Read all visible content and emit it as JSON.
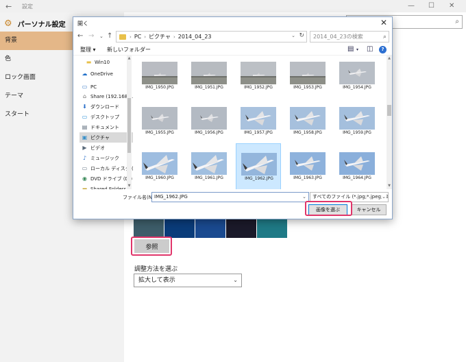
{
  "settings": {
    "title": "設定",
    "sidebar": {
      "header": "パーソナル設定",
      "items": [
        {
          "label": "背景",
          "active": true
        },
        {
          "label": "色",
          "active": false
        },
        {
          "label": "ロック画面",
          "active": false
        },
        {
          "label": "テーマ",
          "active": false
        },
        {
          "label": "スタート",
          "active": false
        }
      ]
    },
    "browse_label": "参照",
    "fit_label": "調整方法を選ぶ",
    "fit_value": "拡大して表示",
    "thumb_colors": [
      "#3d5d6a",
      "#0a3c7a",
      "#1a4a90",
      "#1b1a2a",
      "#1f7a86"
    ]
  },
  "dialog": {
    "title": "開く",
    "breadcrumb": [
      "PC",
      "ピクチャ",
      "2014_04_23"
    ],
    "search_placeholder": "2014_04_23の検索",
    "toolbar": {
      "organize": "整理 ▾",
      "new_folder": "新しいフォルダー"
    },
    "nav": [
      {
        "icon": "folder-icon",
        "label": "Win10",
        "color": "#e8c04a"
      },
      {
        "icon": "cloud-icon",
        "label": "OneDrive",
        "color": "#1f6fc9"
      },
      {
        "icon": "pc-icon",
        "label": "PC",
        "color": "#3a7bc8"
      },
      {
        "icon": "network-share-icon",
        "label": "Share (192.168.1.",
        "color": "#6a6a6a"
      },
      {
        "icon": "download-icon",
        "label": "ダウンロード",
        "color": "#2a6fc9"
      },
      {
        "icon": "desktop-icon",
        "label": "デスクトップ",
        "color": "#2a8fd9"
      },
      {
        "icon": "documents-icon",
        "label": "ドキュメント",
        "color": "#5a6a7a"
      },
      {
        "icon": "pictures-icon",
        "label": "ピクチャ",
        "color": "#3a90c8",
        "selected": true
      },
      {
        "icon": "video-icon",
        "label": "ビデオ",
        "color": "#5a6a7a"
      },
      {
        "icon": "music-icon",
        "label": "ミュージック",
        "color": "#2a6fc9"
      },
      {
        "icon": "disk-icon",
        "label": "ローカル ディスク (C",
        "color": "#6a7a8a"
      },
      {
        "icon": "dvd-icon",
        "label": "DVD ドライブ (D:)",
        "color": "#3a8a5a"
      },
      {
        "icon": "shared-folder-icon",
        "label": "Shared Folders (",
        "color": "#c9a83a"
      }
    ],
    "files": [
      {
        "name": "IMG_1950.JPG",
        "sky": "#b9bcc2",
        "plane": "ground"
      },
      {
        "name": "IMG_1951.JPG",
        "sky": "#b7bbc0",
        "plane": "ground"
      },
      {
        "name": "IMG_1952.JPG",
        "sky": "#bcc0c5",
        "plane": "ground"
      },
      {
        "name": "IMG_1953.JPG",
        "sky": "#b9bdc3",
        "plane": "ground"
      },
      {
        "name": "IMG_1954.JPG",
        "sky": "#b8bec6",
        "plane": "small"
      },
      {
        "name": "IMG_1955.JPG",
        "sky": "#b5bbc3",
        "plane": "small"
      },
      {
        "name": "IMG_1956.JPG",
        "sky": "#b3bac3",
        "plane": "small"
      },
      {
        "name": "IMG_1957.JPG",
        "sky": "#a9c2de",
        "plane": "mid"
      },
      {
        "name": "IMG_1958.JPG",
        "sky": "#a6c0dd",
        "plane": "mid"
      },
      {
        "name": "IMG_1959.JPG",
        "sky": "#a4bfdd",
        "plane": "mid"
      },
      {
        "name": "IMG_1960.JPG",
        "sky": "#9ebde0",
        "plane": "big"
      },
      {
        "name": "IMG_1961.JPG",
        "sky": "#a0bfe0",
        "plane": "big"
      },
      {
        "name": "IMG_1962.JPG",
        "sky": "#94b6dc",
        "plane": "big",
        "selected": true
      },
      {
        "name": "IMG_1963.JPG",
        "sky": "#8eb2dc",
        "plane": "mid"
      },
      {
        "name": "IMG_1964.JPG",
        "sky": "#8aafdb",
        "plane": "mid"
      }
    ],
    "filename_label": "ファイル名(N):",
    "filename_value": "IMG_1962.JPG",
    "filetype_value": "すべてのファイル (*.jpg;*.jpeg;*.bmp",
    "ok_label": "画像を選ぶ",
    "cancel_label": "キャンセル"
  },
  "colors": {
    "accent": "#e4b788",
    "highlight": "#e0356a",
    "selection": "#cce8ff"
  }
}
